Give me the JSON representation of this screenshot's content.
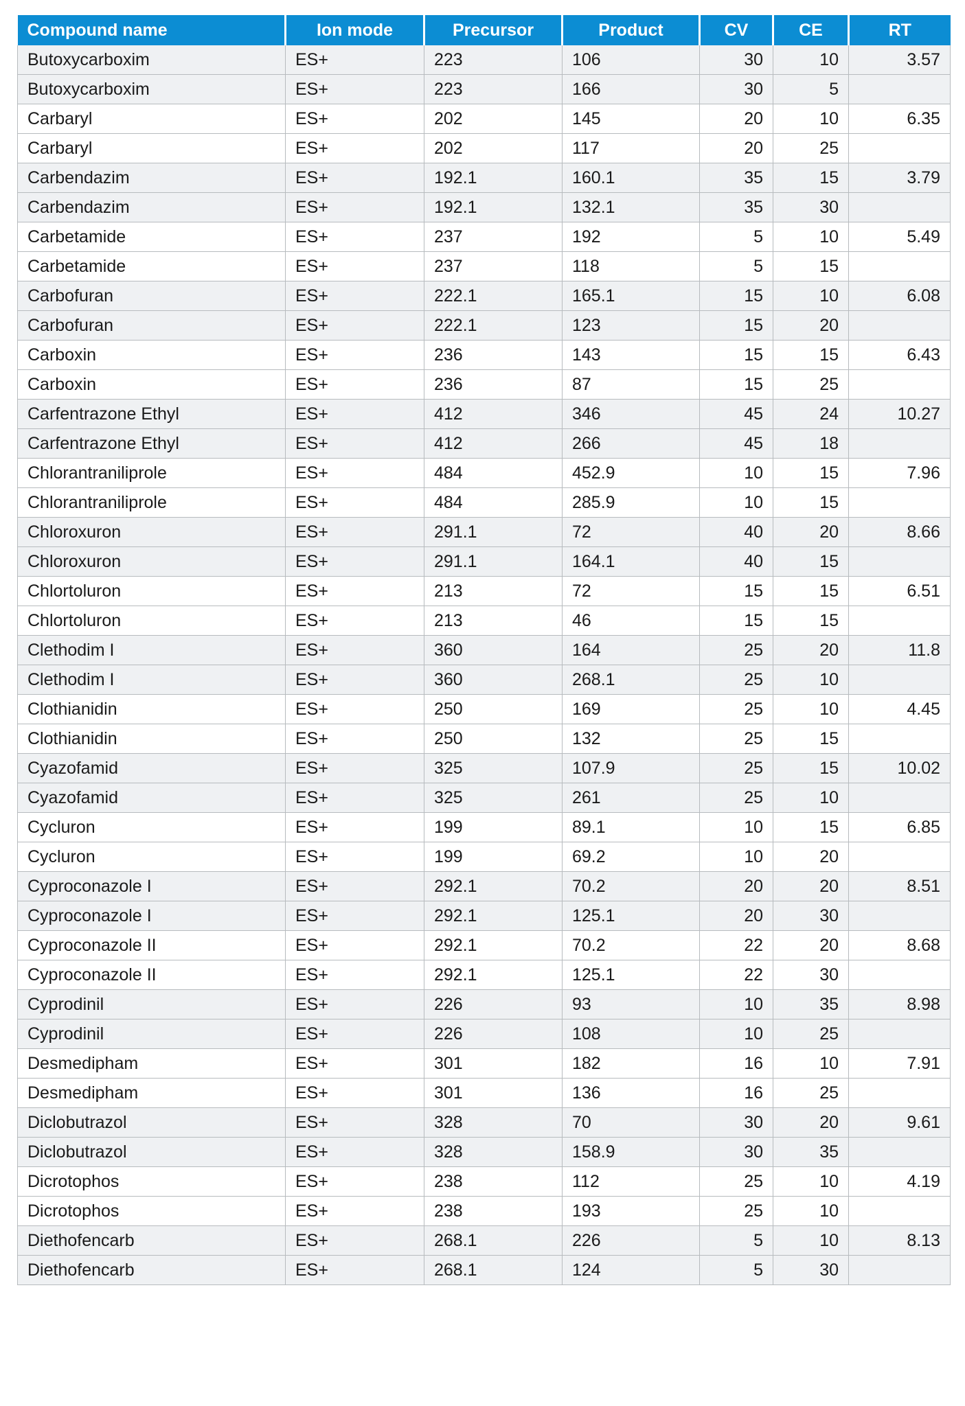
{
  "table": {
    "name": "mrm-transition-table",
    "accent_color": "#0C8DD3",
    "header_text_color": "#FFFFFF",
    "row_shade_color": "#EFF1F3",
    "row_plain_color": "#FFFFFF",
    "grid_color": "#B7BBBE",
    "columns": [
      {
        "key": "compound",
        "label": "Compound name",
        "align": "left"
      },
      {
        "key": "ion_mode",
        "label": "Ion mode",
        "align": "center"
      },
      {
        "key": "precursor",
        "label": "Precursor",
        "align": "right"
      },
      {
        "key": "product",
        "label": "Product",
        "align": "right"
      },
      {
        "key": "cv",
        "label": "CV",
        "align": "right"
      },
      {
        "key": "ce",
        "label": "CE",
        "align": "right"
      },
      {
        "key": "rt",
        "label": "RT",
        "align": "right"
      }
    ],
    "rows": [
      {
        "compound": "Butoxycarboxim",
        "ion_mode": "ES+",
        "precursor": "223",
        "product": "106",
        "cv": "30",
        "ce": "10",
        "rt": "3.57"
      },
      {
        "compound": "Butoxycarboxim",
        "ion_mode": "ES+",
        "precursor": "223",
        "product": "166",
        "cv": "30",
        "ce": "5",
        "rt": ""
      },
      {
        "compound": "Carbaryl",
        "ion_mode": "ES+",
        "precursor": "202",
        "product": "145",
        "cv": "20",
        "ce": "10",
        "rt": "6.35"
      },
      {
        "compound": "Carbaryl",
        "ion_mode": "ES+",
        "precursor": "202",
        "product": "117",
        "cv": "20",
        "ce": "25",
        "rt": ""
      },
      {
        "compound": "Carbendazim",
        "ion_mode": "ES+",
        "precursor": "192.1",
        "product": "160.1",
        "cv": "35",
        "ce": "15",
        "rt": "3.79"
      },
      {
        "compound": "Carbendazim",
        "ion_mode": "ES+",
        "precursor": "192.1",
        "product": "132.1",
        "cv": "35",
        "ce": "30",
        "rt": ""
      },
      {
        "compound": "Carbetamide",
        "ion_mode": "ES+",
        "precursor": "237",
        "product": "192",
        "cv": "5",
        "ce": "10",
        "rt": "5.49"
      },
      {
        "compound": "Carbetamide",
        "ion_mode": "ES+",
        "precursor": "237",
        "product": "118",
        "cv": "5",
        "ce": "15",
        "rt": ""
      },
      {
        "compound": "Carbofuran",
        "ion_mode": "ES+",
        "precursor": "222.1",
        "product": "165.1",
        "cv": "15",
        "ce": "10",
        "rt": "6.08"
      },
      {
        "compound": "Carbofuran",
        "ion_mode": "ES+",
        "precursor": "222.1",
        "product": "123",
        "cv": "15",
        "ce": "20",
        "rt": ""
      },
      {
        "compound": "Carboxin",
        "ion_mode": "ES+",
        "precursor": "236",
        "product": "143",
        "cv": "15",
        "ce": "15",
        "rt": "6.43"
      },
      {
        "compound": "Carboxin",
        "ion_mode": "ES+",
        "precursor": "236",
        "product": "87",
        "cv": "15",
        "ce": "25",
        "rt": ""
      },
      {
        "compound": "Carfentrazone Ethyl",
        "ion_mode": "ES+",
        "precursor": "412",
        "product": "346",
        "cv": "45",
        "ce": "24",
        "rt": "10.27"
      },
      {
        "compound": "Carfentrazone Ethyl",
        "ion_mode": "ES+",
        "precursor": "412",
        "product": "266",
        "cv": "45",
        "ce": "18",
        "rt": ""
      },
      {
        "compound": "Chlorantraniliprole",
        "ion_mode": "ES+",
        "precursor": "484",
        "product": "452.9",
        "cv": "10",
        "ce": "15",
        "rt": "7.96"
      },
      {
        "compound": "Chlorantraniliprole",
        "ion_mode": "ES+",
        "precursor": "484",
        "product": "285.9",
        "cv": "10",
        "ce": "15",
        "rt": ""
      },
      {
        "compound": "Chloroxuron",
        "ion_mode": "ES+",
        "precursor": "291.1",
        "product": "72",
        "cv": "40",
        "ce": "20",
        "rt": "8.66"
      },
      {
        "compound": "Chloroxuron",
        "ion_mode": "ES+",
        "precursor": "291.1",
        "product": "164.1",
        "cv": "40",
        "ce": "15",
        "rt": ""
      },
      {
        "compound": "Chlortoluron",
        "ion_mode": "ES+",
        "precursor": "213",
        "product": "72",
        "cv": "15",
        "ce": "15",
        "rt": "6.51"
      },
      {
        "compound": "Chlortoluron",
        "ion_mode": "ES+",
        "precursor": "213",
        "product": "46",
        "cv": "15",
        "ce": "15",
        "rt": ""
      },
      {
        "compound": "Clethodim I",
        "ion_mode": "ES+",
        "precursor": "360",
        "product": "164",
        "cv": "25",
        "ce": "20",
        "rt": "11.8"
      },
      {
        "compound": "Clethodim I",
        "ion_mode": "ES+",
        "precursor": "360",
        "product": "268.1",
        "cv": "25",
        "ce": "10",
        "rt": ""
      },
      {
        "compound": "Clothianidin",
        "ion_mode": "ES+",
        "precursor": "250",
        "product": "169",
        "cv": "25",
        "ce": "10",
        "rt": "4.45"
      },
      {
        "compound": "Clothianidin",
        "ion_mode": "ES+",
        "precursor": "250",
        "product": "132",
        "cv": "25",
        "ce": "15",
        "rt": ""
      },
      {
        "compound": "Cyazofamid",
        "ion_mode": "ES+",
        "precursor": "325",
        "product": "107.9",
        "cv": "25",
        "ce": "15",
        "rt": "10.02"
      },
      {
        "compound": "Cyazofamid",
        "ion_mode": "ES+",
        "precursor": "325",
        "product": "261",
        "cv": "25",
        "ce": "10",
        "rt": ""
      },
      {
        "compound": "Cycluron",
        "ion_mode": "ES+",
        "precursor": "199",
        "product": "89.1",
        "cv": "10",
        "ce": "15",
        "rt": "6.85"
      },
      {
        "compound": "Cycluron",
        "ion_mode": "ES+",
        "precursor": "199",
        "product": "69.2",
        "cv": "10",
        "ce": "20",
        "rt": ""
      },
      {
        "compound": "Cyproconazole I",
        "ion_mode": "ES+",
        "precursor": "292.1",
        "product": "70.2",
        "cv": "20",
        "ce": "20",
        "rt": "8.51"
      },
      {
        "compound": "Cyproconazole I",
        "ion_mode": "ES+",
        "precursor": "292.1",
        "product": "125.1",
        "cv": "20",
        "ce": "30",
        "rt": ""
      },
      {
        "compound": "Cyproconazole II",
        "ion_mode": "ES+",
        "precursor": "292.1",
        "product": "70.2",
        "cv": "22",
        "ce": "20",
        "rt": "8.68"
      },
      {
        "compound": "Cyproconazole II",
        "ion_mode": "ES+",
        "precursor": "292.1",
        "product": "125.1",
        "cv": "22",
        "ce": "30",
        "rt": ""
      },
      {
        "compound": "Cyprodinil",
        "ion_mode": "ES+",
        "precursor": "226",
        "product": "93",
        "cv": "10",
        "ce": "35",
        "rt": "8.98"
      },
      {
        "compound": "Cyprodinil",
        "ion_mode": "ES+",
        "precursor": "226",
        "product": "108",
        "cv": "10",
        "ce": "25",
        "rt": ""
      },
      {
        "compound": "Desmedipham",
        "ion_mode": "ES+",
        "precursor": "301",
        "product": "182",
        "cv": "16",
        "ce": "10",
        "rt": "7.91"
      },
      {
        "compound": "Desmedipham",
        "ion_mode": "ES+",
        "precursor": "301",
        "product": "136",
        "cv": "16",
        "ce": "25",
        "rt": ""
      },
      {
        "compound": "Diclobutrazol",
        "ion_mode": "ES+",
        "precursor": "328",
        "product": "70",
        "cv": "30",
        "ce": "20",
        "rt": "9.61"
      },
      {
        "compound": "Diclobutrazol",
        "ion_mode": "ES+",
        "precursor": "328",
        "product": "158.9",
        "cv": "30",
        "ce": "35",
        "rt": ""
      },
      {
        "compound": "Dicrotophos",
        "ion_mode": "ES+",
        "precursor": "238",
        "product": "112",
        "cv": "25",
        "ce": "10",
        "rt": "4.19"
      },
      {
        "compound": "Dicrotophos",
        "ion_mode": "ES+",
        "precursor": "238",
        "product": "193",
        "cv": "25",
        "ce": "10",
        "rt": ""
      },
      {
        "compound": "Diethofencarb",
        "ion_mode": "ES+",
        "precursor": "268.1",
        "product": "226",
        "cv": "5",
        "ce": "10",
        "rt": "8.13"
      },
      {
        "compound": "Diethofencarb",
        "ion_mode": "ES+",
        "precursor": "268.1",
        "product": "124",
        "cv": "5",
        "ce": "30",
        "rt": ""
      }
    ]
  }
}
